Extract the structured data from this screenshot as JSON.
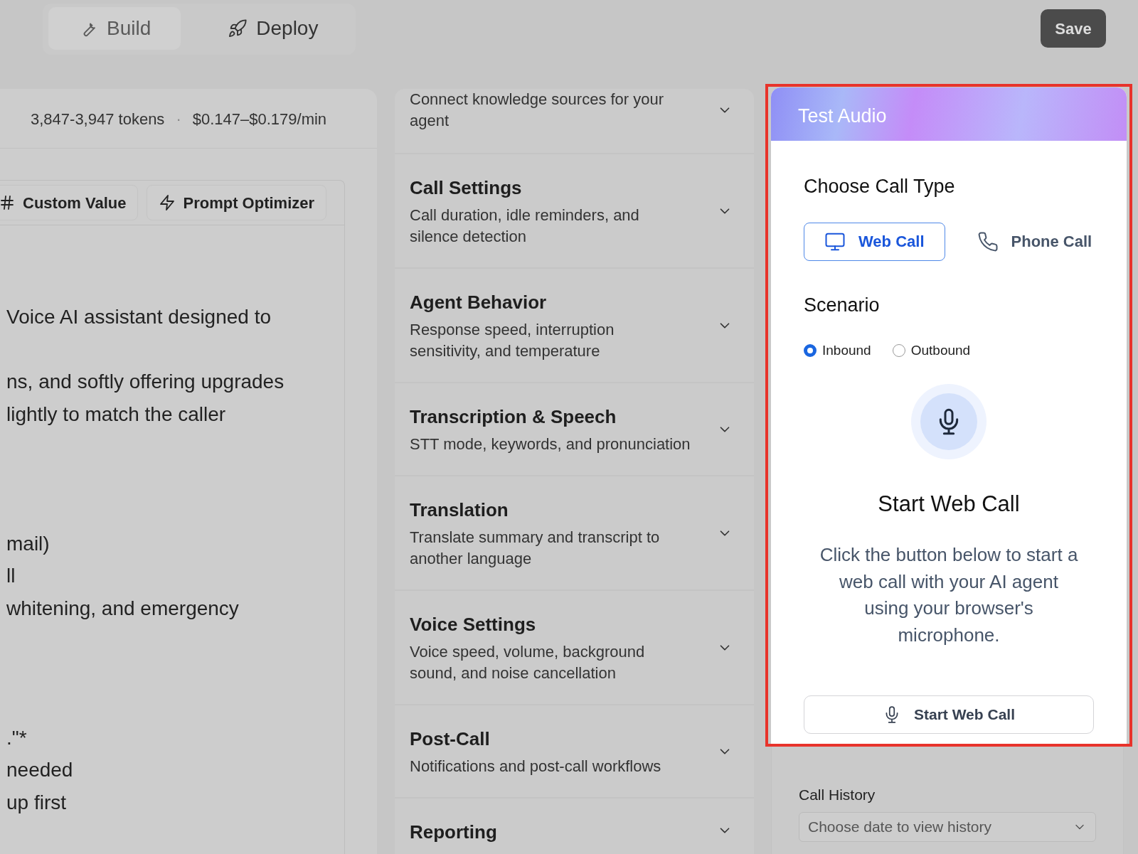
{
  "top_tabs": [
    {
      "label": "Build",
      "selected": true
    },
    {
      "label": "Deploy",
      "selected": false
    }
  ],
  "save_button": "Save",
  "prompt_panel": {
    "token_count": "3,847-3,947 tokens",
    "separator": "·",
    "cost": "$0.147–$0.179/min",
    "toolbar": [
      "Custom Value",
      "Prompt Optimizer"
    ],
    "editor_paragraphs": [
      [
        "Voice AI assistant designed to"
      ],
      [
        "ns, and softly offering upgrades",
        "lightly to match the caller"
      ],
      [
        "mail)",
        "ll",
        "whitening, and emergency"
      ],
      [
        ".\"*",
        "needed",
        "up first"
      ]
    ]
  },
  "settings_sections": [
    {
      "description": "Connect knowledge sources for your\nagent"
    },
    {
      "title": "Call Settings",
      "description": "Call duration, idle reminders, and\nsilence detection"
    },
    {
      "title": "Agent Behavior",
      "description": "Response speed, interruption\nsensitivity, and temperature"
    },
    {
      "title": "Transcription & Speech",
      "description": "STT mode, keywords, and pronunciation"
    },
    {
      "title": "Translation",
      "description": "Translate summary and transcript to\nanother language"
    },
    {
      "title": "Voice Settings",
      "description": "Voice speed, volume, background\nsound, and noise cancellation"
    },
    {
      "title": "Post-Call",
      "description": "Notifications and post-call workflows"
    },
    {
      "title": "Reporting"
    }
  ],
  "test_audio": {
    "title": "Test Audio",
    "call_type_label": "Choose Call Type",
    "call_types": [
      {
        "label": "Web Call",
        "selected": true
      },
      {
        "label": "Phone Call",
        "selected": false
      }
    ],
    "scenario_label": "Scenario",
    "scenarios": [
      {
        "label": "Inbound",
        "selected": true
      },
      {
        "label": "Outbound",
        "selected": false
      }
    ],
    "heading": "Start Web Call",
    "message": "Click the button below to start a\nweb call with your AI agent\nusing your browser's\nmicrophone.",
    "start_button": "Start Web Call"
  },
  "call_history": {
    "label": "Call History",
    "placeholder": "Choose date to view history"
  }
}
